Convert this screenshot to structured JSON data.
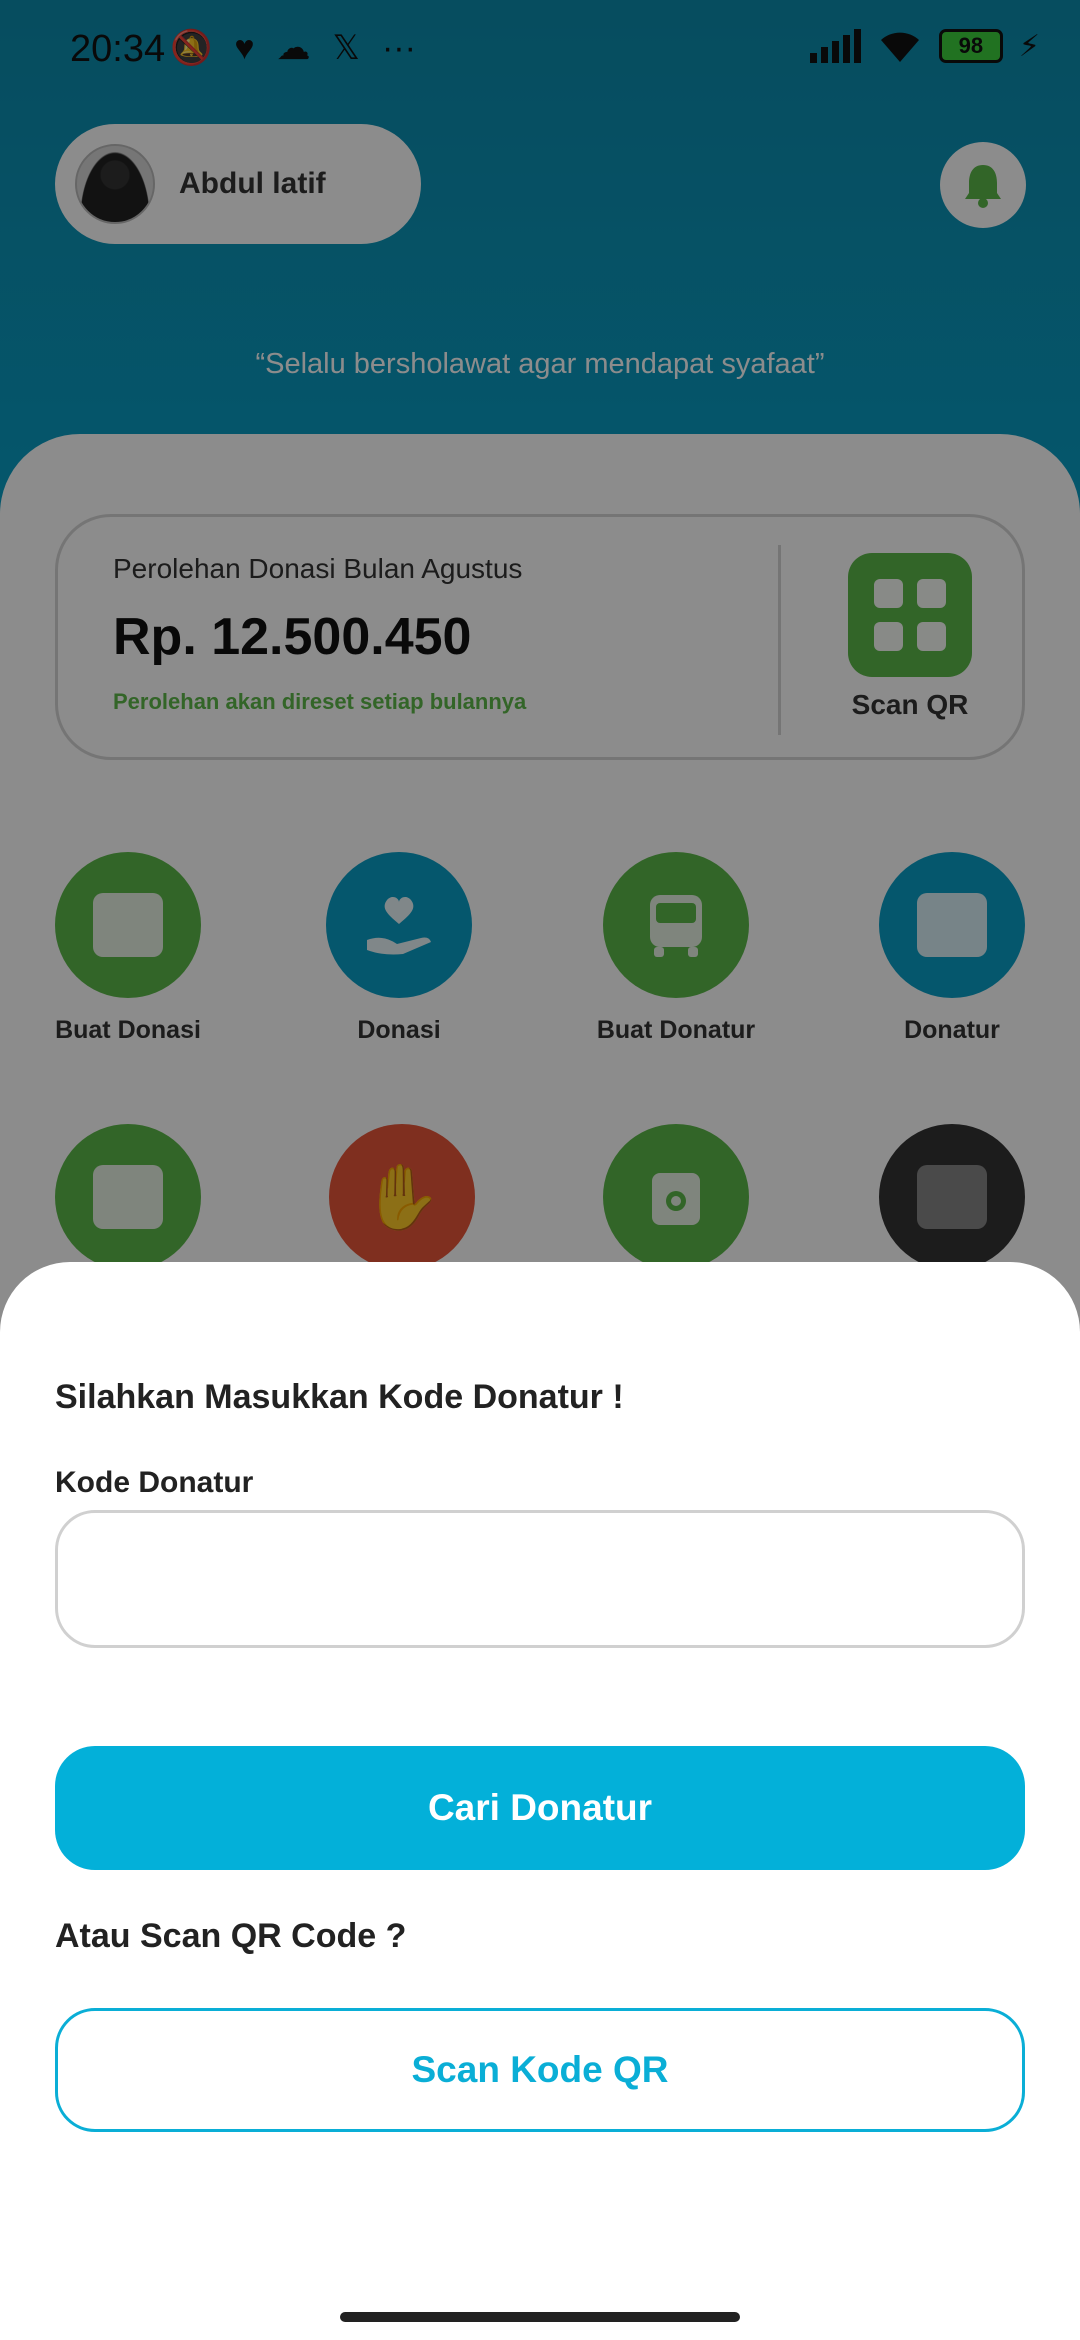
{
  "status_bar": {
    "time": "20:34",
    "left_icons": [
      "bell-off-icon",
      "lazada-icon",
      "cloud-icon",
      "x-icon",
      "more-icon"
    ],
    "battery_level": "98",
    "right_icons": [
      "signal-icon",
      "wifi-icon",
      "battery-icon",
      "charging-icon"
    ]
  },
  "header": {
    "user_name": "Abdul latif",
    "quote": "“Selalu bersholawat agar mendapat syafaat”"
  },
  "donation_card": {
    "title": "Perolehan Donasi Bulan Agustus",
    "amount": "Rp. 12.500.450",
    "note": "Perolehan akan direset setiap bulannya",
    "scan_label": "Scan QR"
  },
  "menu": {
    "items": [
      {
        "label": "Buat Donasi",
        "icon": "donation-form-icon"
      },
      {
        "label": "Donasi",
        "icon": "heart-hand-icon"
      },
      {
        "label": "Buat Donatur",
        "icon": "bus-icon"
      },
      {
        "label": "Donatur",
        "icon": "receipt-icon"
      }
    ],
    "row2_icons": [
      "donation-form-icon",
      "hand-wave-icon",
      "wallet-icon",
      "receipt-icon"
    ]
  },
  "sheet": {
    "title": "Silahkan Masukkan Kode Donatur !",
    "field_label": "Kode Donatur",
    "field_value": "",
    "search_button": "Cari Donatur",
    "or_text": "Atau Scan QR Code ?",
    "scan_button": "Scan Kode QR"
  },
  "colors": {
    "primary": "#03b0d9",
    "green": "#5cb84a",
    "red": "#e8563a",
    "header": "#0a9fc6"
  }
}
